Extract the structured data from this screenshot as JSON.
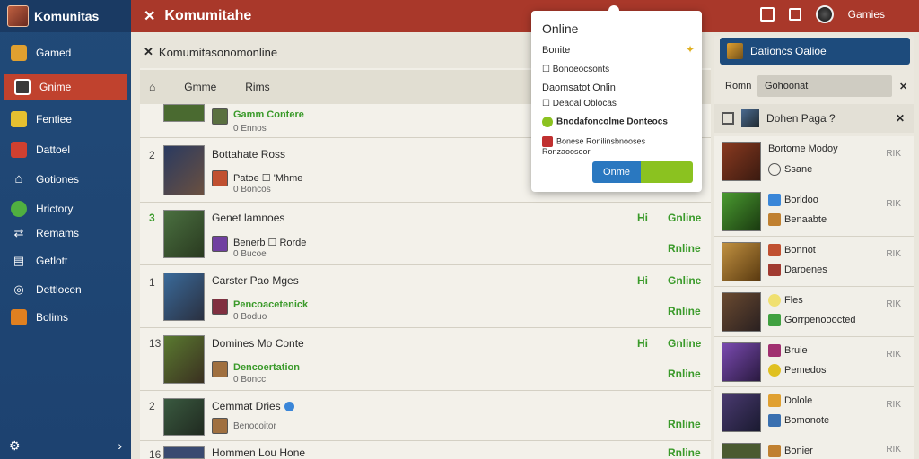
{
  "sidebar": {
    "title": "Komunitas",
    "items": [
      {
        "label": "Gamed",
        "icon": "gamepad-icon",
        "color": "#e0a030"
      },
      {
        "label": "Gnime",
        "icon": "monitor-icon",
        "color": "#d04030",
        "active": true
      },
      {
        "label": "Fentiee",
        "icon": "store-icon",
        "color": "#e6c030"
      },
      {
        "label": "Dattoel",
        "icon": "shop-icon",
        "color": "#d04030"
      },
      {
        "label": "Gotiones",
        "icon": "home-icon",
        "color": "#ffffff"
      },
      {
        "label": "Hrictory",
        "icon": "globe-icon",
        "color": "#50b040"
      },
      {
        "label": "Remams",
        "icon": "shuffle-icon",
        "color": "#ffffff"
      },
      {
        "label": "Getlott",
        "icon": "document-icon",
        "color": "#ffffff"
      },
      {
        "label": "Dettlocen",
        "icon": "compass-icon",
        "color": "#ffffff"
      },
      {
        "label": "Bolims",
        "icon": "grid-icon",
        "color": "#e08020"
      }
    ],
    "footer_left": "⚙",
    "footer_right": "›"
  },
  "topbar": {
    "close": "✕",
    "title": "Komumitahe",
    "user": "Gamies"
  },
  "main": {
    "header_close": "✕",
    "header_title": "Komumitasonomonline",
    "tabs": {
      "back": "⌂",
      "first": "Gmme",
      "second": "Rims"
    },
    "rows": [
      {
        "num": "",
        "name": "",
        "sub": "Gamm Contere",
        "sub_green": true,
        "subs": "0 Ennos",
        "h": "",
        "status": "",
        "status2": "",
        "thumb": "#4a6a30",
        "sicon": "#5a7040",
        "check": false
      },
      {
        "num": "2",
        "name": "Bottahate Ross",
        "sub": "Patoe ☐ 'Mhme",
        "sub_green": false,
        "subs": "0 Boncos",
        "h": "",
        "status": "",
        "status2": "",
        "thumb": "#2a3a60",
        "sicon": "#c05030",
        "check": false
      },
      {
        "num": "3",
        "name": "Genet lamnoes",
        "sub": "Benerb ☐ Rorde",
        "sub_green": false,
        "subs": "0 Bucoe",
        "h": "Hi",
        "status": "Gnline",
        "status2": "Rnline",
        "thumb": "#4a7040",
        "sicon": "#7040a0",
        "check": false
      },
      {
        "num": "1",
        "name": "Carster Pao Mges",
        "sub": "Pencoacetenick",
        "sub_green": true,
        "subs": "0 Boduo",
        "h": "Hi",
        "status": "Gnline",
        "status2": "Rnline",
        "thumb": "#3a5a7a",
        "sicon": "#803040",
        "check": false
      },
      {
        "num": "13",
        "name": "Domines Mo Conte",
        "sub": "Dencoertation",
        "sub_green": true,
        "subs": "0 Boncc",
        "h": "Hi",
        "status": "Gnline",
        "status2": "Rnline",
        "thumb": "#5a6a30",
        "sicon": "#a07040",
        "check": false
      },
      {
        "num": "2",
        "name": "Cemmat Dries",
        "sub": "",
        "sub_green": false,
        "subs": "Benocoitor",
        "h": "",
        "status": "",
        "status2": "Rnline",
        "thumb": "#3a4a40",
        "sicon": "#a07040",
        "check": true
      },
      {
        "num": "16",
        "name": "Hommen Lou Hone",
        "sub": "",
        "sub_green": false,
        "subs": "",
        "h": "",
        "status": "",
        "status2": "Rnline",
        "thumb": "#3a4a70",
        "sicon": "#5a5a70",
        "check": false
      }
    ]
  },
  "popover": {
    "title": "Online",
    "line1": "Bonite",
    "line2": "☐ Bonoeocsonts",
    "line3": "Daomsatot Onlin",
    "line4": "☐ Deaoal Oblocas",
    "line5": "Bnodafoncolme Donteocs",
    "line6": "Bonese Ronilinsbnooses Ronzaoosoor",
    "button": "Onme"
  },
  "rightpanel": {
    "header": "Dationcs Oalioe",
    "search_label": "Romn",
    "search_value": "Gohoonat",
    "search_clear": "✕",
    "sub_title": "Dohen Paga ?",
    "sub_close": "✕",
    "items": [
      {
        "l1": "Bortome Modoy",
        "l2": "Ssane",
        "tag": "RIK",
        "thumb": "#6a2a20",
        "c1": "",
        "c2": "#ffffff"
      },
      {
        "l1": "Borldoo",
        "l2": "Benaabte",
        "tag": "RIK",
        "thumb": "#3a7a30",
        "c1": "#3a86d8",
        "c2": "#c08030"
      },
      {
        "l1": "Bonnot",
        "l2": "Daroenes",
        "tag": "RIK",
        "thumb": "#a07a30",
        "c1": "#c05030",
        "c2": "#a03a30"
      },
      {
        "l1": "Fles",
        "l2": "Gorrpenooocted",
        "tag": "RIK",
        "thumb": "#5a3a30",
        "c1": "#f0e070",
        "c2": "#40a040"
      },
      {
        "l1": "Bruie",
        "l2": "Pemedos",
        "tag": "RIK",
        "thumb": "#5a3a80",
        "c1": "#a03070",
        "c2": "#e0c020"
      },
      {
        "l1": "Dolole",
        "l2": "Bomonote",
        "tag": "RIK",
        "thumb": "#3a2a50",
        "c1": "#e0a030",
        "c2": "#3a70b0"
      },
      {
        "l1": "Bonier",
        "l2": "",
        "tag": "RIK",
        "thumb": "#4a5a30",
        "c1": "#c08030",
        "c2": ""
      }
    ]
  }
}
